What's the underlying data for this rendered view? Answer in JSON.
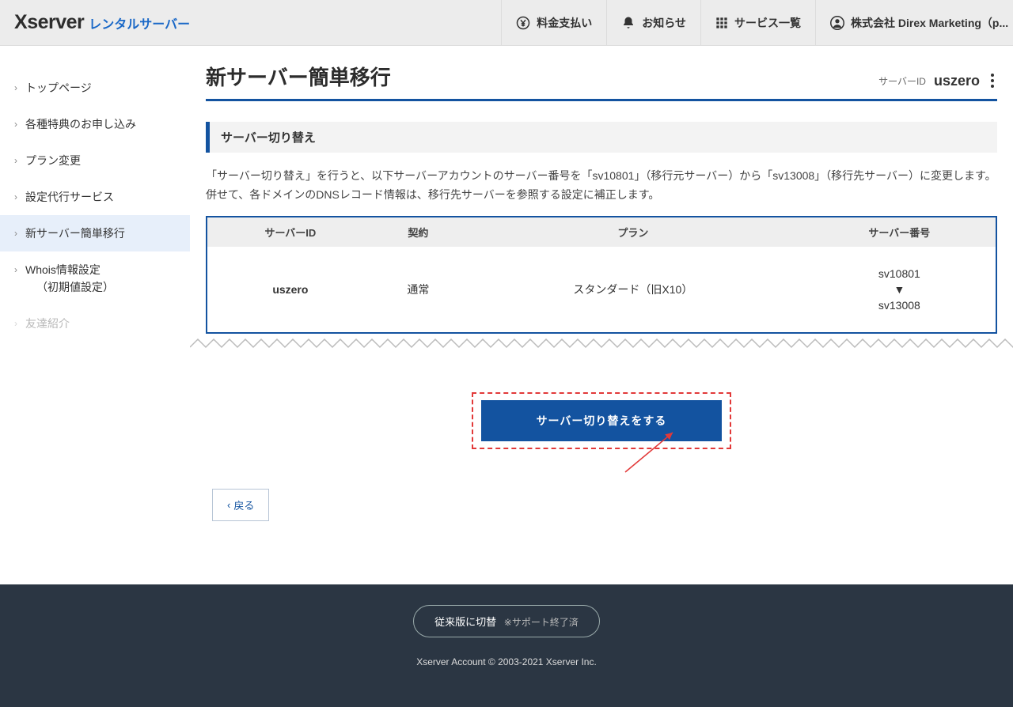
{
  "header": {
    "logo_main": "Xserver",
    "logo_tag": "レンタルサーバー",
    "nav": {
      "payment": "料金支払い",
      "notice": "お知らせ",
      "services": "サービス一覧",
      "user": "株式会社 Direx Marketing（p..."
    }
  },
  "sidebar": {
    "items": [
      {
        "label": "トップページ"
      },
      {
        "label": "各種特典のお申し込み"
      },
      {
        "label": "プラン変更"
      },
      {
        "label": "設定代行サービス"
      },
      {
        "label": "新サーバー簡単移行",
        "active": true
      },
      {
        "label": "Whois情報設定",
        "sub": "（初期値設定）"
      },
      {
        "label": "友達紹介",
        "faded": true
      }
    ]
  },
  "page": {
    "title": "新サーバー簡単移行",
    "server_id_label": "サーバーID",
    "server_id_value": "uszero"
  },
  "section": {
    "title": "サーバー切り替え",
    "description": "「サーバー切り替え」を行うと、以下サーバーアカウントのサーバー番号を「sv10801」（移行元サーバー）から「sv13008」（移行先サーバー）に変更します。併せて、各ドメインのDNSレコード情報は、移行先サーバーを参照する設定に補正します。"
  },
  "table": {
    "headers": {
      "id": "サーバーID",
      "contract": "契約",
      "plan": "プラン",
      "server_no": "サーバー番号"
    },
    "row": {
      "id": "uszero",
      "contract": "通常",
      "plan": "スタンダード（旧X10）",
      "server_from": "sv10801",
      "server_arrow": "▼",
      "server_to": "sv13008"
    }
  },
  "actions": {
    "primary": "サーバー切り替えをする",
    "back": "戻る"
  },
  "footer": {
    "legacy_btn": "従来版に切替",
    "legacy_note": "※サポート終了済",
    "copyright": "Xserver Account © 2003-2021 Xserver Inc."
  }
}
